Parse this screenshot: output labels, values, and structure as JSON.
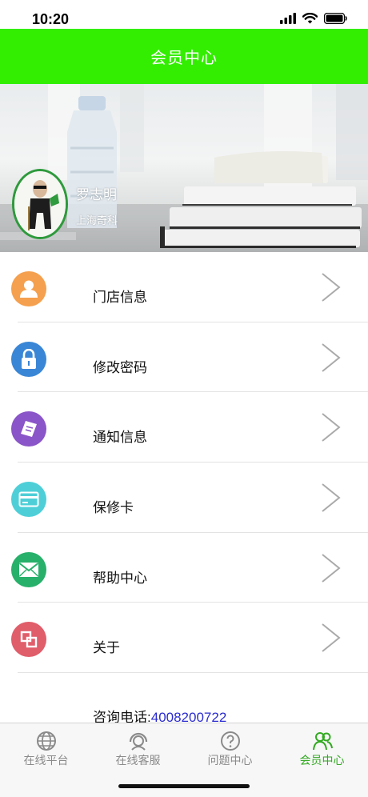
{
  "status": {
    "time": "10:20"
  },
  "header": {
    "title": "会员中心"
  },
  "profile": {
    "name": "罗志明",
    "company": "上海奇科"
  },
  "menu": {
    "items": [
      {
        "label": "门店信息",
        "icon": "person-icon",
        "color": "#f5a04e"
      },
      {
        "label": "修改密码",
        "icon": "lock-icon",
        "color": "#3a86d6"
      },
      {
        "label": "通知信息",
        "icon": "notebook-icon",
        "color": "#8a55c8"
      },
      {
        "label": "保修卡",
        "icon": "card-icon",
        "color": "#4ecfd8"
      },
      {
        "label": "帮助中心",
        "icon": "mail-icon",
        "color": "#27b06a"
      },
      {
        "label": "关于",
        "icon": "about-icon",
        "color": "#e05d6a"
      }
    ]
  },
  "hotline": {
    "label": "咨询电话:",
    "phone": "4008200722"
  },
  "tabs": [
    {
      "label": "在线平台",
      "icon": "globe-icon"
    },
    {
      "label": "在线客服",
      "icon": "headset-icon"
    },
    {
      "label": "问题中心",
      "icon": "question-icon"
    },
    {
      "label": "会员中心",
      "icon": "members-icon",
      "active": true
    }
  ],
  "colors": {
    "accent": "#33ee00",
    "tab_active": "#33aa22",
    "phone_link": "#2b2bd1"
  }
}
